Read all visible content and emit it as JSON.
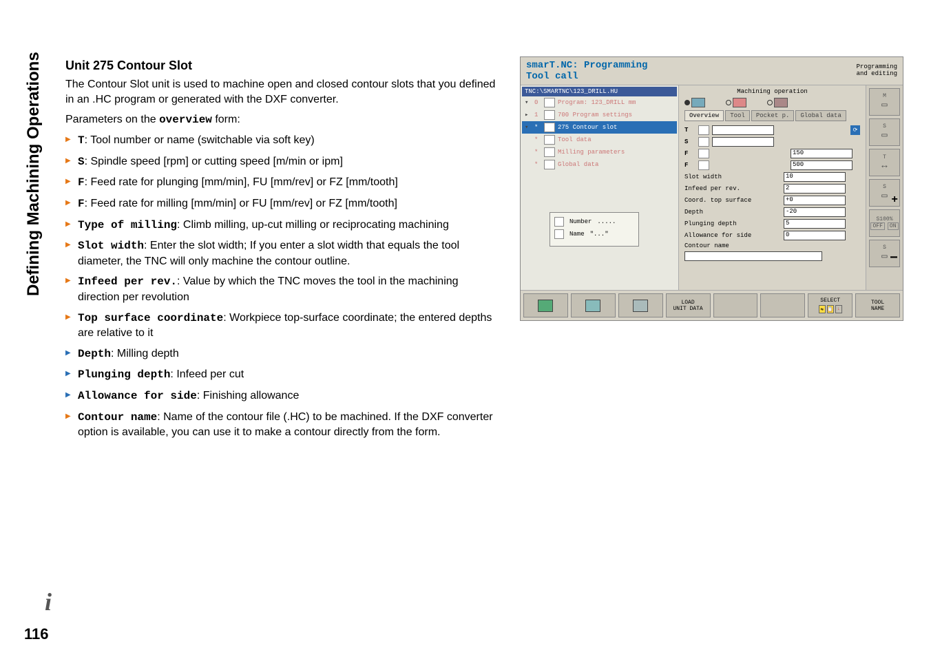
{
  "sidebar_label": "Defining Machining Operations",
  "page_number": "116",
  "heading": "Unit 275 Contour Slot",
  "intro": "The Contour Slot unit is used to machine open and closed contour slots that you defined in an .HC program or generated with the DXF converter.",
  "overview_pre": "Parameters on the ",
  "overview_word": "overview",
  "overview_post": " form:",
  "bullets": [
    {
      "cls": "orange",
      "label": "T",
      "text": ": Tool number or name (switchable via soft key)"
    },
    {
      "cls": "orange",
      "label": "S",
      "text": ": Spindle speed [rpm] or cutting speed [m/min or ipm]"
    },
    {
      "cls": "orange",
      "label": "F",
      "text": ": Feed rate for plunging [mm/min], FU [mm/rev] or FZ [mm/tooth]"
    },
    {
      "cls": "orange",
      "label": "F",
      "text": ": Feed rate for milling [mm/min] or FU [mm/rev] or FZ [mm/tooth]"
    },
    {
      "cls": "orange",
      "label": "Type of milling",
      "text": ": Climb milling, up-cut milling or reciprocating machining"
    },
    {
      "cls": "orange",
      "label": "Slot width",
      "text": ": Enter the slot width; If you enter a slot width that equals the tool diameter, the TNC will only machine the contour outline."
    },
    {
      "cls": "orange",
      "label": "Infeed per rev.",
      "text": ": Value by which the TNC moves the tool in the machining direction per revolution"
    },
    {
      "cls": "orange",
      "label": "Top surface coordinate",
      "text": ": Workpiece top-surface coordinate; the entered depths are relative to it"
    },
    {
      "cls": "blue",
      "label": "Depth",
      "text": ": Milling depth"
    },
    {
      "cls": "blue",
      "label": "Plunging depth",
      "text": ": Infeed per cut"
    },
    {
      "cls": "blue",
      "label": "Allowance for side",
      "text": ": Finishing allowance"
    },
    {
      "cls": "orange",
      "label": "Contour name",
      "text": ": Name of the contour file (.HC) to be machined. If the DXF converter option is available, you can use it to make a contour directly from the form."
    }
  ],
  "panel": {
    "title": "smarT.NC: Programming",
    "subtitle": "Tool call",
    "status_line1": "Programming",
    "status_line2": "and editing",
    "path": "TNC:\\SMARTNC\\123_DRILL.HU",
    "tree": [
      {
        "exp": "▾",
        "idx": "0",
        "txt": "Program: 123_DRILL mm",
        "sel": false
      },
      {
        "exp": "▸",
        "idx": "1",
        "txt": "700 Program settings",
        "sel": false
      },
      {
        "exp": "▾",
        "idx": "*",
        "txt": "275 Contour slot",
        "sel": true
      },
      {
        "exp": "",
        "idx": "*",
        "txt": "Tool data",
        "sel": false
      },
      {
        "exp": "",
        "idx": "*",
        "txt": "Milling parameters",
        "sel": false
      },
      {
        "exp": "",
        "idx": "*",
        "txt": "Global data",
        "sel": false
      }
    ],
    "numname": {
      "number_label": "Number",
      "number_val": ".....",
      "name_label": "Name",
      "name_val": "\"...\""
    },
    "machining_operation": "Machining operation",
    "tabs": [
      "Overview",
      "Tool",
      "Pocket p.",
      "Global data"
    ],
    "fields": {
      "T": "T",
      "S": "S",
      "F1": "F",
      "F2": "F",
      "F1_val": "150",
      "F2_val": "500",
      "slot_width_label": "Slot width",
      "slot_width_val": "10",
      "infeed_label": "Infeed per rev.",
      "infeed_val": "2",
      "coord_label": "Coord. top surface",
      "coord_val": "+0",
      "depth_label": "Depth",
      "depth_val": "-20",
      "plunging_label": "Plunging depth",
      "plunging_val": "5",
      "allowance_label": "Allowance for side",
      "allowance_val": "0",
      "contour_label": "Contour name",
      "contour_val": ""
    },
    "side": {
      "M": "M",
      "S": "S",
      "T": "T",
      "S2": "S",
      "s100": "S100%",
      "off": "OFF",
      "on": "ON"
    },
    "footer": {
      "load_unit_data_l1": "LOAD",
      "load_unit_data_l2": "UNIT DATA",
      "select": "SELECT",
      "tool_name_l1": "TOOL",
      "tool_name_l2": "NAME"
    }
  }
}
